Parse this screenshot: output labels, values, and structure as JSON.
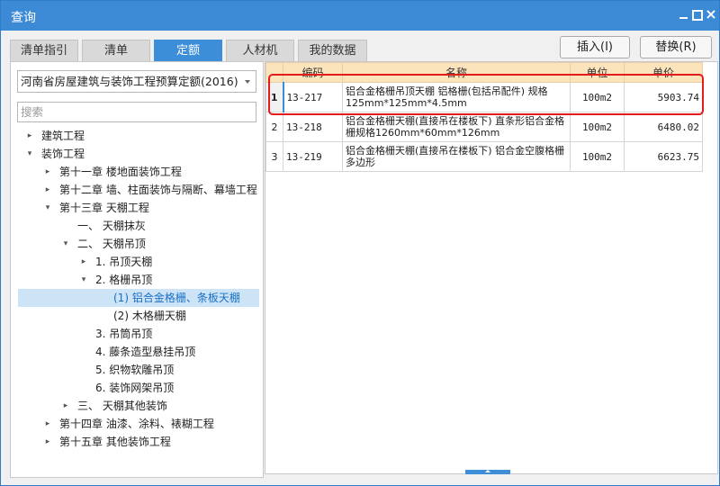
{
  "window": {
    "title": "查询"
  },
  "titlebar_buttons": {
    "minimize": "minimize-icon",
    "maximize": "maximize-icon",
    "close": "close-icon",
    "close_glyph": "×"
  },
  "tabs": [
    {
      "label": "清单指引"
    },
    {
      "label": "清单"
    },
    {
      "label": "定额",
      "active": true
    },
    {
      "label": "人材机"
    },
    {
      "label": "我的数据"
    }
  ],
  "actions": {
    "insert": "插入(I)",
    "replace": "替换(R)"
  },
  "left": {
    "quota_library": "河南省房屋建筑与装饰工程预算定额(2016)",
    "search_placeholder": "搜索",
    "tree": [
      {
        "label": "建筑工程",
        "depth": 0,
        "state": "collapsed"
      },
      {
        "label": "装饰工程",
        "depth": 0,
        "state": "expanded"
      },
      {
        "label": "第十一章 楼地面装饰工程",
        "depth": 1,
        "state": "collapsed"
      },
      {
        "label": "第十二章 墙、柱面装饰与隔断、幕墙工程",
        "depth": 1,
        "state": "collapsed"
      },
      {
        "label": "第十三章 天棚工程",
        "depth": 1,
        "state": "expanded"
      },
      {
        "label": "一、 天棚抹灰",
        "depth": 2,
        "state": "leaf"
      },
      {
        "label": "二、 天棚吊顶",
        "depth": 2,
        "state": "expanded"
      },
      {
        "label": "1. 吊顶天棚",
        "depth": 3,
        "state": "collapsed"
      },
      {
        "label": "2. 格栅吊顶",
        "depth": 3,
        "state": "expanded"
      },
      {
        "label": "(1) 铝合金格栅、条板天棚",
        "depth": 4,
        "state": "leaf",
        "selected": true
      },
      {
        "label": "(2) 木格栅天棚",
        "depth": 4,
        "state": "leaf"
      },
      {
        "label": "3. 吊筒吊顶",
        "depth": 3,
        "state": "leaf"
      },
      {
        "label": "4. 藤条造型悬挂吊顶",
        "depth": 3,
        "state": "leaf"
      },
      {
        "label": "5. 织物软雕吊顶",
        "depth": 3,
        "state": "leaf"
      },
      {
        "label": "6. 装饰网架吊顶",
        "depth": 3,
        "state": "leaf"
      },
      {
        "label": "三、 天棚其他装饰",
        "depth": 2,
        "state": "collapsed"
      },
      {
        "label": "第十四章 油漆、涂料、裱糊工程",
        "depth": 1,
        "state": "collapsed"
      },
      {
        "label": "第十五章 其他装饰工程",
        "depth": 1,
        "state": "collapsed"
      }
    ]
  },
  "table": {
    "columns": [
      "",
      "编码",
      "名称",
      "单位",
      "单价"
    ],
    "rows": [
      {
        "index": "1",
        "code": "13-217",
        "name": "铝合金格栅吊顶天棚 铝格栅(包括吊配件) 规格125mm*125mm*4.5mm",
        "unit": "100m2",
        "price": "5903.74",
        "current": true
      },
      {
        "index": "2",
        "code": "13-218",
        "name": "铝合金格栅天棚(直接吊在楼板下) 直条形铝合金格栅规格1260mm*60mm*126mm",
        "unit": "100m2",
        "price": "6480.02"
      },
      {
        "index": "3",
        "code": "13-219",
        "name": "铝合金格栅天棚(直接吊在楼板下) 铝合金空腹格栅 多边形",
        "unit": "100m2",
        "price": "6623.75"
      }
    ]
  },
  "colors": {
    "titlebar": "#3c8ad6",
    "active_tab": "#3d8ed8",
    "header_bg": "#fbe3bb",
    "selected_row": "#cde4f7",
    "highlight_border": "#e51c1c"
  },
  "icons": {
    "expanded": "▾",
    "collapsed": "▸"
  }
}
